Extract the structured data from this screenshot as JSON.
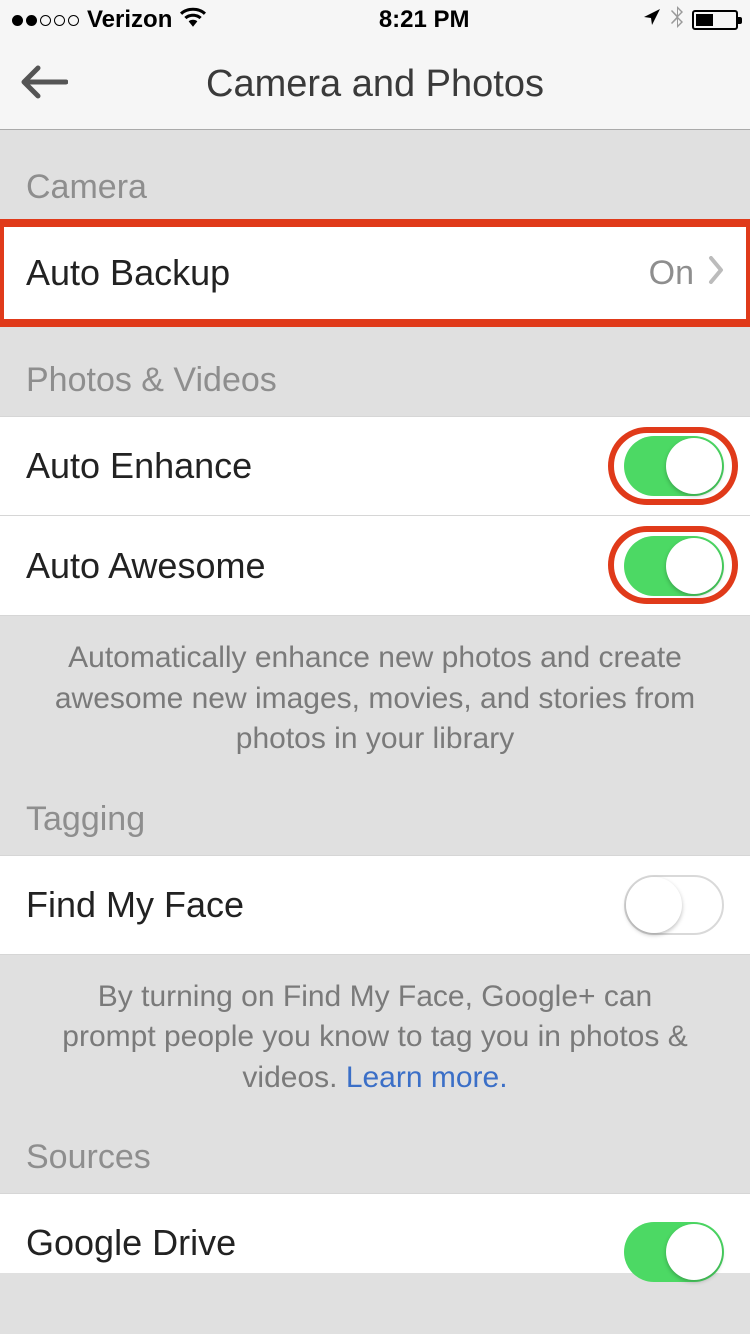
{
  "status": {
    "carrier": "Verizon",
    "time": "8:21 PM"
  },
  "nav": {
    "title": "Camera and Photos"
  },
  "sections": {
    "camera": {
      "header": "Camera",
      "auto_backup": {
        "label": "Auto Backup",
        "value": "On"
      }
    },
    "photos_videos": {
      "header": "Photos & Videos",
      "auto_enhance": {
        "label": "Auto Enhance",
        "on": true
      },
      "auto_awesome": {
        "label": "Auto Awesome",
        "on": true
      },
      "footer": "Automatically enhance new photos and create awesome new images, movies, and stories from photos in your library"
    },
    "tagging": {
      "header": "Tagging",
      "find_my_face": {
        "label": "Find My Face",
        "on": false
      },
      "footer_pre": "By turning on Find My Face, Google+ can prompt people you know to tag you in photos & videos. ",
      "footer_link": "Learn more."
    },
    "sources": {
      "header": "Sources",
      "google_drive": {
        "label": "Google Drive",
        "on": true
      }
    }
  }
}
